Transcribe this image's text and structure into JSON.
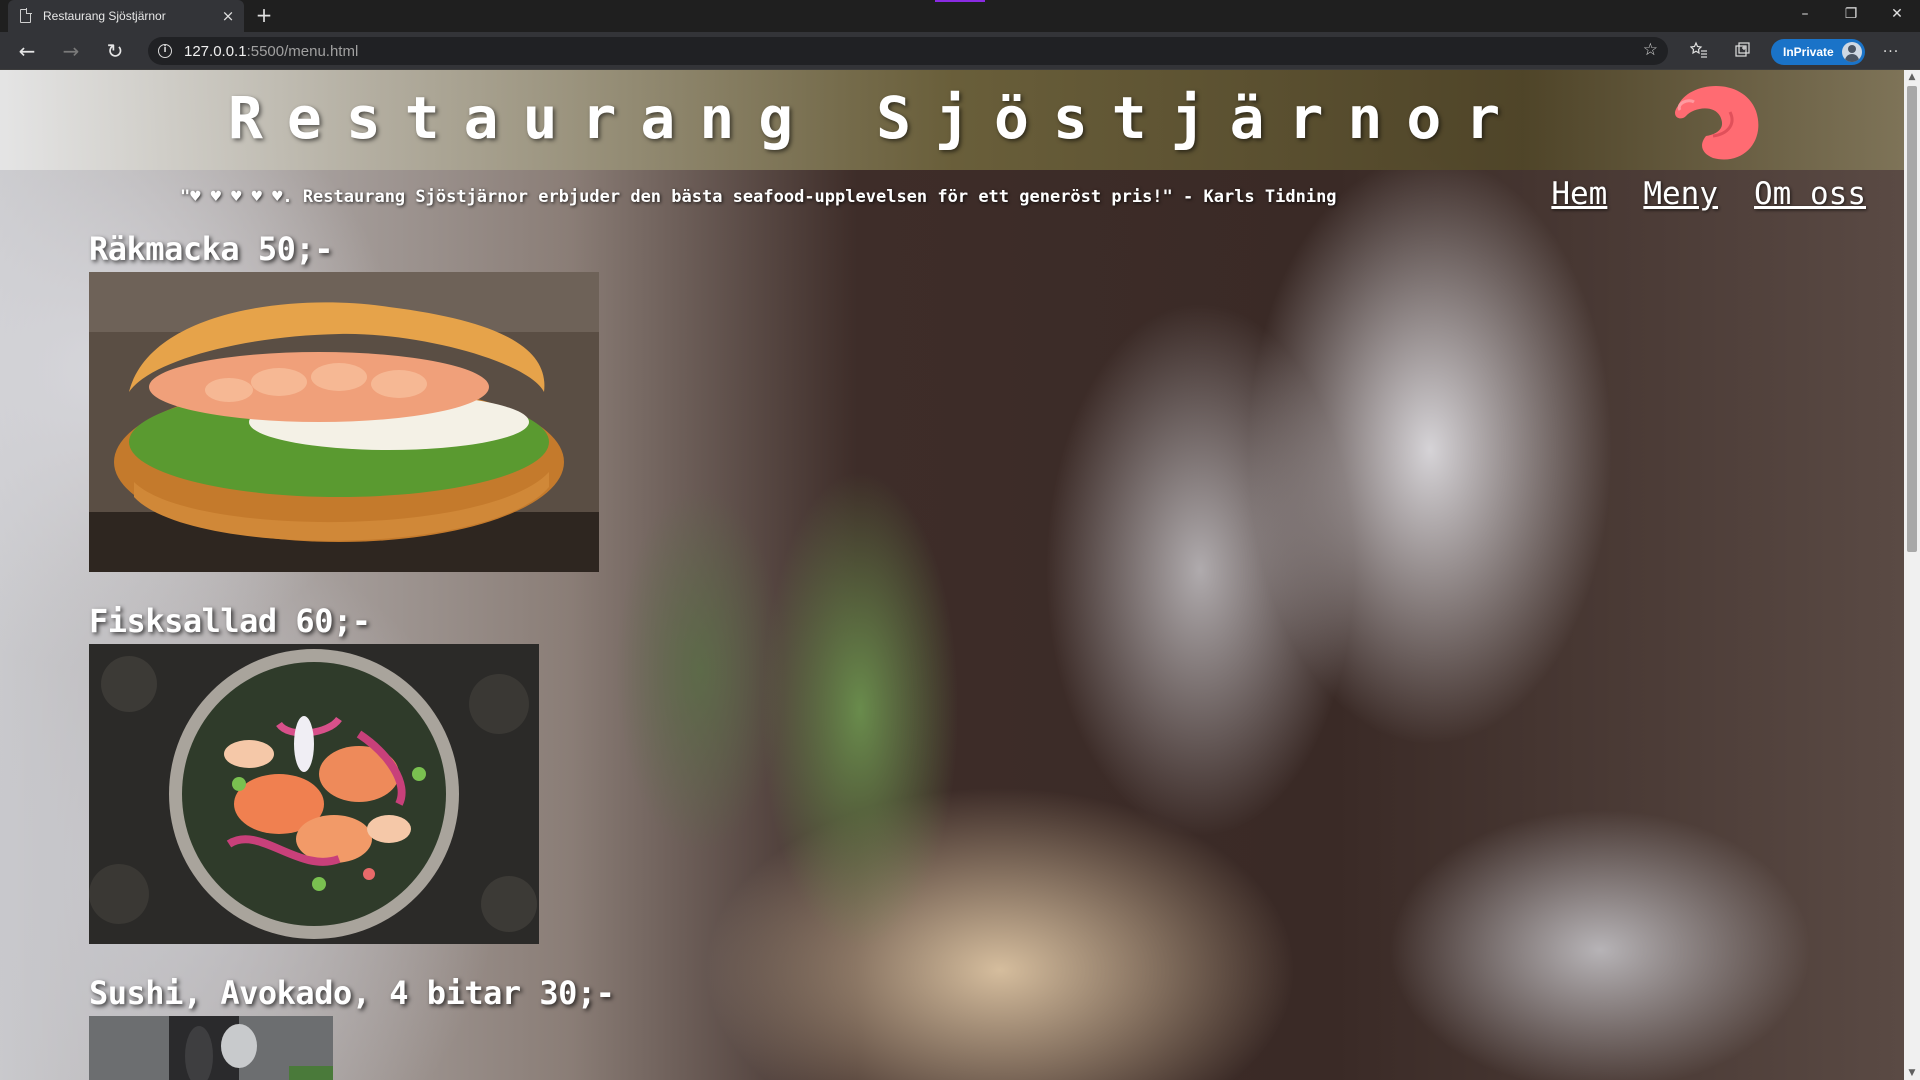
{
  "browser": {
    "tab_title": "Restaurang Sjöstjärnor",
    "tab_close": "×",
    "new_tab": "+",
    "url_host": "127.0.0.1",
    "url_rest": ":5500/menu.html",
    "inprivate_label": "InPrivate",
    "window_controls": {
      "minimize": "–",
      "restore": "❐",
      "close": "✕"
    },
    "nav": {
      "back": "←",
      "forward": "→",
      "reload": "↻"
    },
    "star": "☆",
    "more": "···"
  },
  "site": {
    "title": "Restaurang Sjöstjärnor",
    "quote": "\"♥ ♥ ♥ ♥ ♥. Restaurang Sjöstjärnor erbjuder den bästa seafood-upplevelsen för ett generöst pris!\" - Karls Tidning",
    "nav": [
      {
        "label": "Hem"
      },
      {
        "label": "Meny"
      },
      {
        "label": "Om oss"
      }
    ]
  },
  "menu": [
    {
      "title": "Räkmacka 50;-"
    },
    {
      "title": "Fisksallad 60;-"
    },
    {
      "title": "Sushi, Avokado, 4 bitar 30;-"
    }
  ]
}
